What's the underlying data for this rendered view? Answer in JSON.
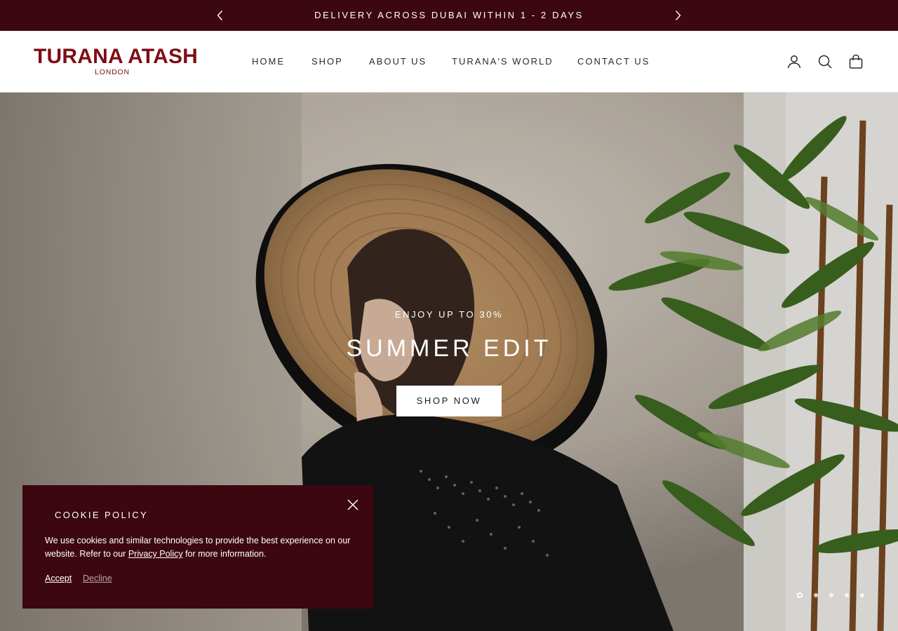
{
  "colors": {
    "brand_burgundy": "#3c0711",
    "logo_red": "#7e0e14",
    "white": "#ffffff"
  },
  "announcement": {
    "text": "DELIVERY ACROSS DUBAI WITHIN 1 - 2 DAYS",
    "prev_icon": "chevron-left-icon",
    "next_icon": "chevron-right-icon"
  },
  "header": {
    "logo": {
      "main": "TURANA ATASH",
      "sub": "LONDON"
    },
    "nav": [
      {
        "label": "HOME"
      },
      {
        "label": "SHOP"
      },
      {
        "label": "ABOUT US"
      },
      {
        "label": "TURANA'S WORLD"
      },
      {
        "label": "CONTACT US"
      }
    ],
    "icons": [
      "account-icon",
      "search-icon",
      "cart-bag-icon"
    ]
  },
  "hero": {
    "eyebrow": "ENJOY UP TO 30%",
    "title": "SUMMER EDIT",
    "button_label": "SHOP NOW",
    "slide_count": 5,
    "active_slide": 1
  },
  "cookie": {
    "title": "COOKIE POLICY",
    "text_before": "We use cookies and similar technologies to provide the best experience on our website. Refer to our ",
    "link_label": "Privacy Policy",
    "text_after": " for more information.",
    "accept_label": "Accept",
    "decline_label": "Decline",
    "close_icon": "close-icon"
  }
}
